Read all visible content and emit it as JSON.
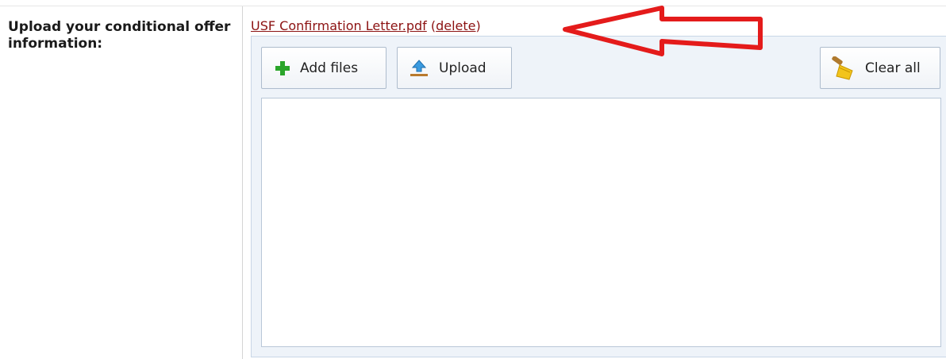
{
  "form": {
    "label": "Upload your conditional offer information:",
    "file_name": "USF Confirmation Letter.pdf",
    "delete_open": " (",
    "delete_label": "delete",
    "delete_close": ")"
  },
  "toolbar": {
    "add_label": "Add files",
    "add_icon": "plus-icon",
    "upload_label": "Upload",
    "upload_icon": "upload-arrow-icon",
    "clear_label": "Clear all",
    "clear_icon": "broom-icon"
  },
  "colors": {
    "link": "#8c1212",
    "annotation_arrow": "#e41b1b",
    "panel_bg": "#eef3f9",
    "plus_green": "#2aa52a"
  }
}
